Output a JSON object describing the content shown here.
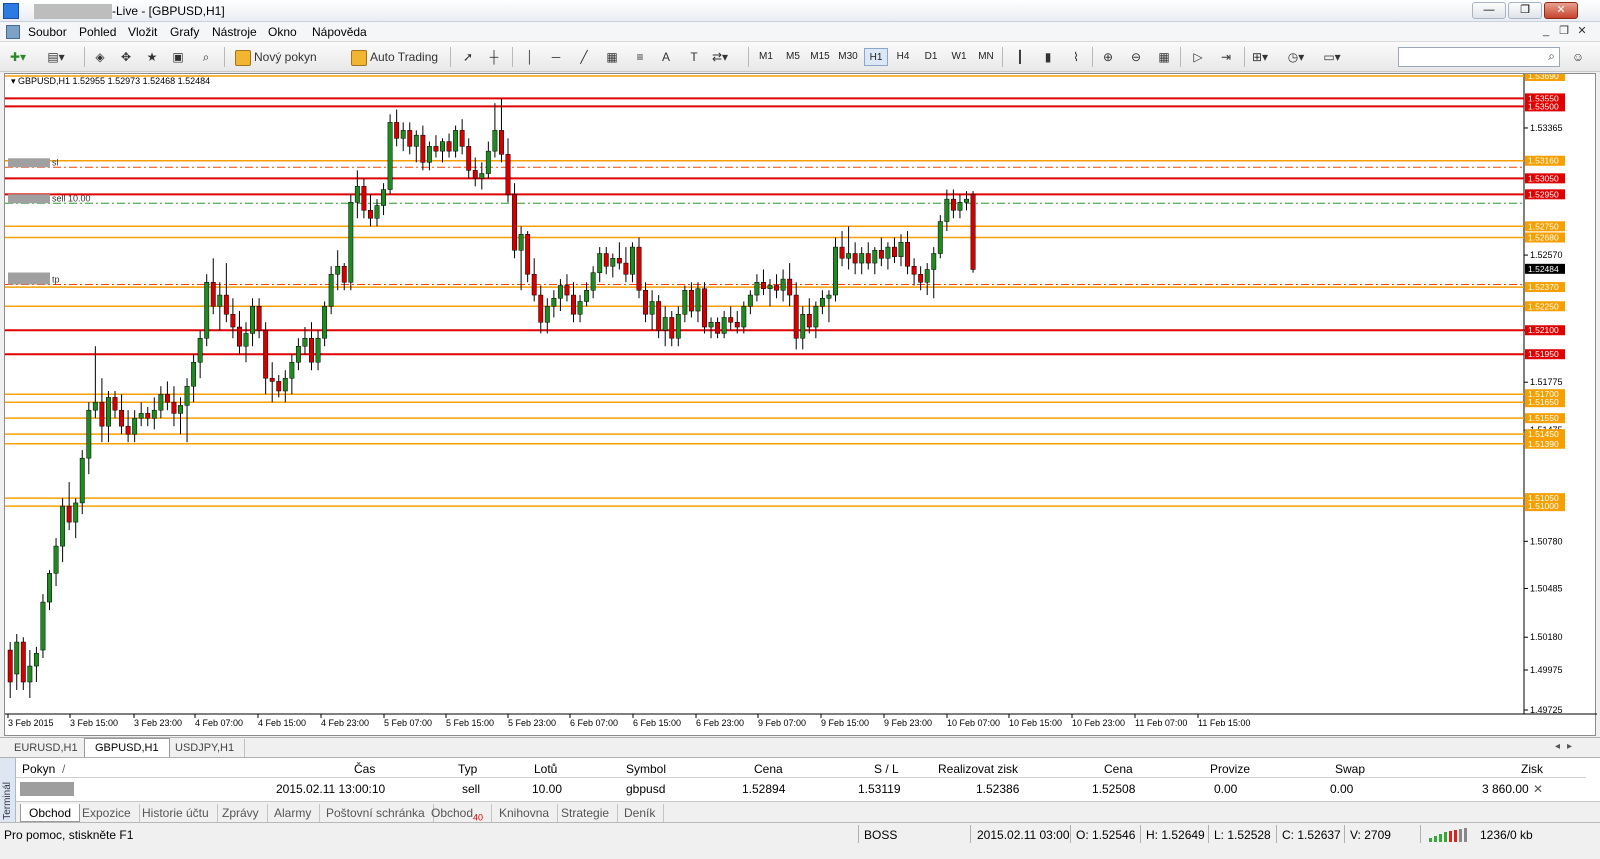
{
  "window": {
    "title": "-Live - [GBPUSD,H1]",
    "min": "—",
    "max": "❐",
    "close": "✕"
  },
  "menu": [
    "Soubor",
    "Pohled",
    "Vložit",
    "Grafy",
    "Nástroje",
    "Okno",
    "Nápověda"
  ],
  "toolbar": {
    "new_order": "Nový pokyn",
    "auto_trading": "Auto Trading",
    "timeframes": [
      "M1",
      "M5",
      "M15",
      "M30",
      "H1",
      "H4",
      "D1",
      "W1",
      "MN"
    ],
    "active_tf": "H1"
  },
  "chart": {
    "header": "GBPUSD,H1  1.52955 1.52973 1.52468 1.52484",
    "price_axis": [
      "1.53365",
      "1.52570",
      "1.52100",
      "1.51775",
      "1.51475",
      "1.50780",
      "1.50485",
      "1.50180",
      "1.49975",
      "1.49725"
    ],
    "level_tags": [
      "1.53690",
      "1.53550",
      "1.53500",
      "1.53160",
      "1.53050",
      "1.52950",
      "1.52750",
      "1.52680",
      "1.52484",
      "1.52370",
      "1.52250",
      "1.52100",
      "1.51950",
      "1.51700",
      "1.51650",
      "1.51550",
      "1.51450",
      "1.51390",
      "1.51050",
      "1.51000"
    ],
    "time_axis": [
      "3 Feb 2015",
      "3 Feb 15:00",
      "3 Feb 23:00",
      "4 Feb 07:00",
      "4 Feb 15:00",
      "4 Feb 23:00",
      "5 Feb 07:00",
      "5 Feb 15:00",
      "5 Feb 23:00",
      "6 Feb 07:00",
      "6 Feb 15:00",
      "6 Feb 23:00",
      "9 Feb 07:00",
      "9 Feb 15:00",
      "9 Feb 23:00",
      "10 Feb 07:00",
      "10 Feb 15:00",
      "10 Feb 23:00",
      "11 Feb 07:00",
      "11 Feb 15:00"
    ],
    "order_labels": {
      "sl": "sl",
      "sell": "sell 10.00",
      "tp": "tp"
    },
    "colors": {
      "bull": "#1f8a1f",
      "bear": "#d40000",
      "red_line": "#e00000",
      "orange_line": "#f5a000"
    }
  },
  "chart_tabs": [
    "EURUSD,H1",
    "GBPUSD,H1",
    "USDJPY,H1"
  ],
  "terminal": {
    "side_label": "Terminál",
    "headers": [
      "Pokyn",
      "/",
      "Čas",
      "Typ",
      "Lotů",
      "Symbol",
      "Cena",
      "S / L",
      "Realizovat zisk",
      "Cena",
      "Provize",
      "Swap",
      "Zisk"
    ],
    "row": {
      "time": "2015.02.11 13:00:10",
      "type": "sell",
      "lots": "10.00",
      "symbol": "gbpusd",
      "price": "1.52894",
      "sl": "1.53119",
      "tp": "1.52386",
      "cur_price": "1.52508",
      "commission": "0.00",
      "swap": "0.00",
      "profit": "3 860.00"
    },
    "tabs": [
      "Obchod",
      "Expozice",
      "Historie účtu",
      "Zprávy",
      "Alarmy",
      "Poštovní schránka",
      "Obchod",
      "Knihovna",
      "Strategie",
      "Deník"
    ],
    "badge": "40"
  },
  "status": {
    "help": "Pro pomoc, stiskněte F1",
    "profile": "BOSS",
    "datetime": "2015.02.11 03:00",
    "open": "O: 1.52546",
    "high": "H: 1.52649",
    "low": "L: 1.52528",
    "close": "C: 1.52637",
    "volume": "V: 2709",
    "traffic": "1236/0 kb"
  }
}
